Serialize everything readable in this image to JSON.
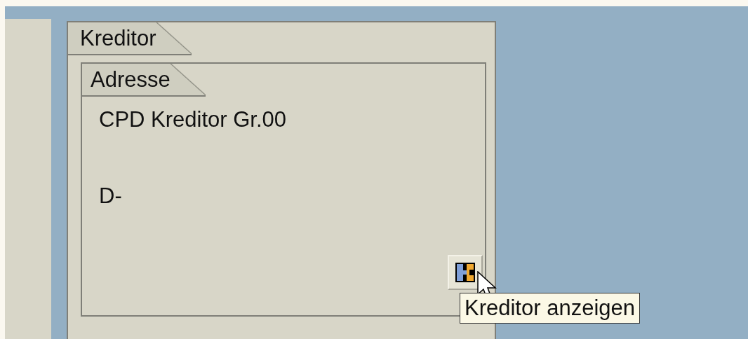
{
  "group": {
    "title": "Kreditor",
    "address": {
      "title": "Adresse",
      "name_line": "CPD Kreditor Gr.00",
      "city_line": "D-"
    }
  },
  "tooltip": "Kreditor anzeigen"
}
